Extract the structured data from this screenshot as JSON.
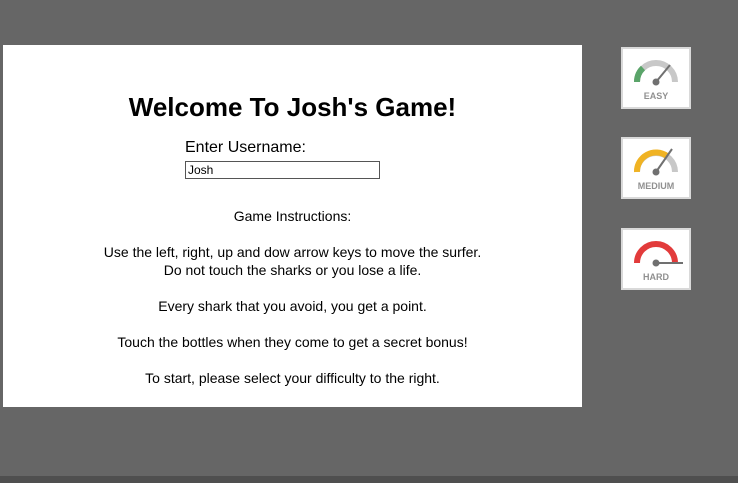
{
  "game": {
    "title": "Welcome To Josh's Game!",
    "username_label": "Enter Username:",
    "username_value": "Josh",
    "instructions": {
      "heading": "Game Instructions:",
      "line1": "Use the left, right, up and dow arrow keys to move the surfer.",
      "line2": "Do not touch the sharks or you lose a life.",
      "line3": "Every shark that you avoid, you get a point.",
      "line4": "Touch the bottles when they come to get a secret bonus!",
      "line5": "To start, please select your difficulty to the right."
    }
  },
  "difficulty": {
    "easy": {
      "label": "EASY",
      "color": "#5aa469",
      "icon": "speedometer-low-icon"
    },
    "medium": {
      "label": "MEDIUM",
      "color": "#f0b323",
      "icon": "speedometer-medium-icon"
    },
    "hard": {
      "label": "HARD",
      "color": "#e23b3b",
      "icon": "speedometer-high-icon"
    }
  }
}
